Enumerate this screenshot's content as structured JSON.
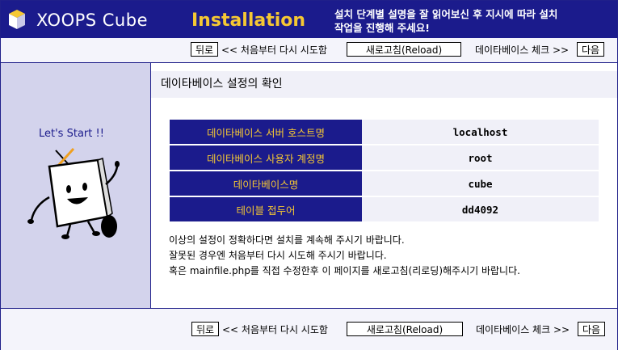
{
  "header": {
    "brand": "XOOPS Cube",
    "title": "Installation",
    "notice_line1": "설치 단계별 설명을 잘 읽어보신 후 지시에 따라 설치",
    "notice_line2": "작업을 진행해 주세요!"
  },
  "nav": {
    "back_label": "뒤로",
    "back_hint": "<< 처음부터 다시 시도함",
    "reload_label": "새로고침(Reload)",
    "next_hint": "데이타베이스 체크 >>",
    "next_label": "다음"
  },
  "sidebar": {
    "lets_start": "Let's Start !!"
  },
  "main": {
    "title": "데이타베이스 설정의 확인",
    "rows": [
      {
        "label": "데이타베이스 서버 호스트명",
        "value": "localhost"
      },
      {
        "label": "데이타베이스 사용자 계정명",
        "value": "root"
      },
      {
        "label": "데이타베이스명",
        "value": "cube"
      },
      {
        "label": "테이블 접두어",
        "value": "dd4092"
      }
    ],
    "messages": [
      "이상의 설정이 정확하다면 설치를 계속해 주시기 바랍니다.",
      "잘못된 경우엔 처음부터 다시 시도해 주시기 바랍니다.",
      "혹은 mainfile.php를 직접 수정한후 이 페이지를 새로고침(리로딩)해주시기 바랍니다."
    ]
  },
  "colors": {
    "header_bg": "#1b1b8c",
    "accent": "#f6c833",
    "sidebar_bg": "#d3d3ec"
  }
}
